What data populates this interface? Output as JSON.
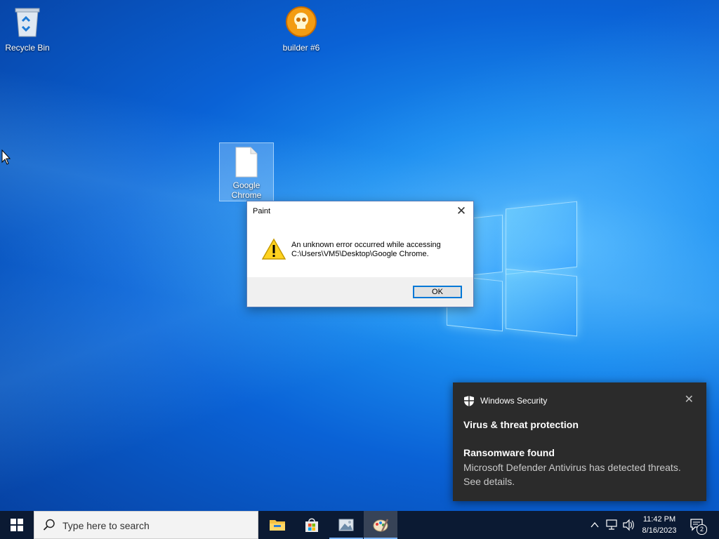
{
  "desktop": {
    "icons": [
      {
        "label": "Recycle Bin",
        "icon": "recycle-bin-icon"
      },
      {
        "label": "builder #6",
        "icon": "skull-icon"
      },
      {
        "label": "Google Chrome",
        "icon": "blank-file-icon"
      }
    ]
  },
  "dialog": {
    "title": "Paint",
    "message_line1": "An unknown error occurred while accessing",
    "message_line2": "C:\\Users\\VM5\\Desktop\\Google Chrome.",
    "ok_label": "OK",
    "close_glyph": "✕"
  },
  "toast": {
    "app_name": "Windows Security",
    "heading": "Virus & threat protection",
    "subheading": "Ransomware found",
    "body": "Microsoft Defender Antivirus has detected threats.  See details.",
    "close_glyph": "✕"
  },
  "taskbar": {
    "search_placeholder": "Type here to search",
    "apps": [
      "file-explorer-icon",
      "microsoft-store-icon",
      "image-viewer-icon",
      "paint-icon"
    ],
    "clock": {
      "time": "11:42 PM",
      "date": "8/16/2023"
    },
    "notification_count": "2"
  },
  "colors": {
    "accent": "#0078d7",
    "taskbar": "#0b1a33",
    "toast_bg": "#2b2b2b"
  }
}
